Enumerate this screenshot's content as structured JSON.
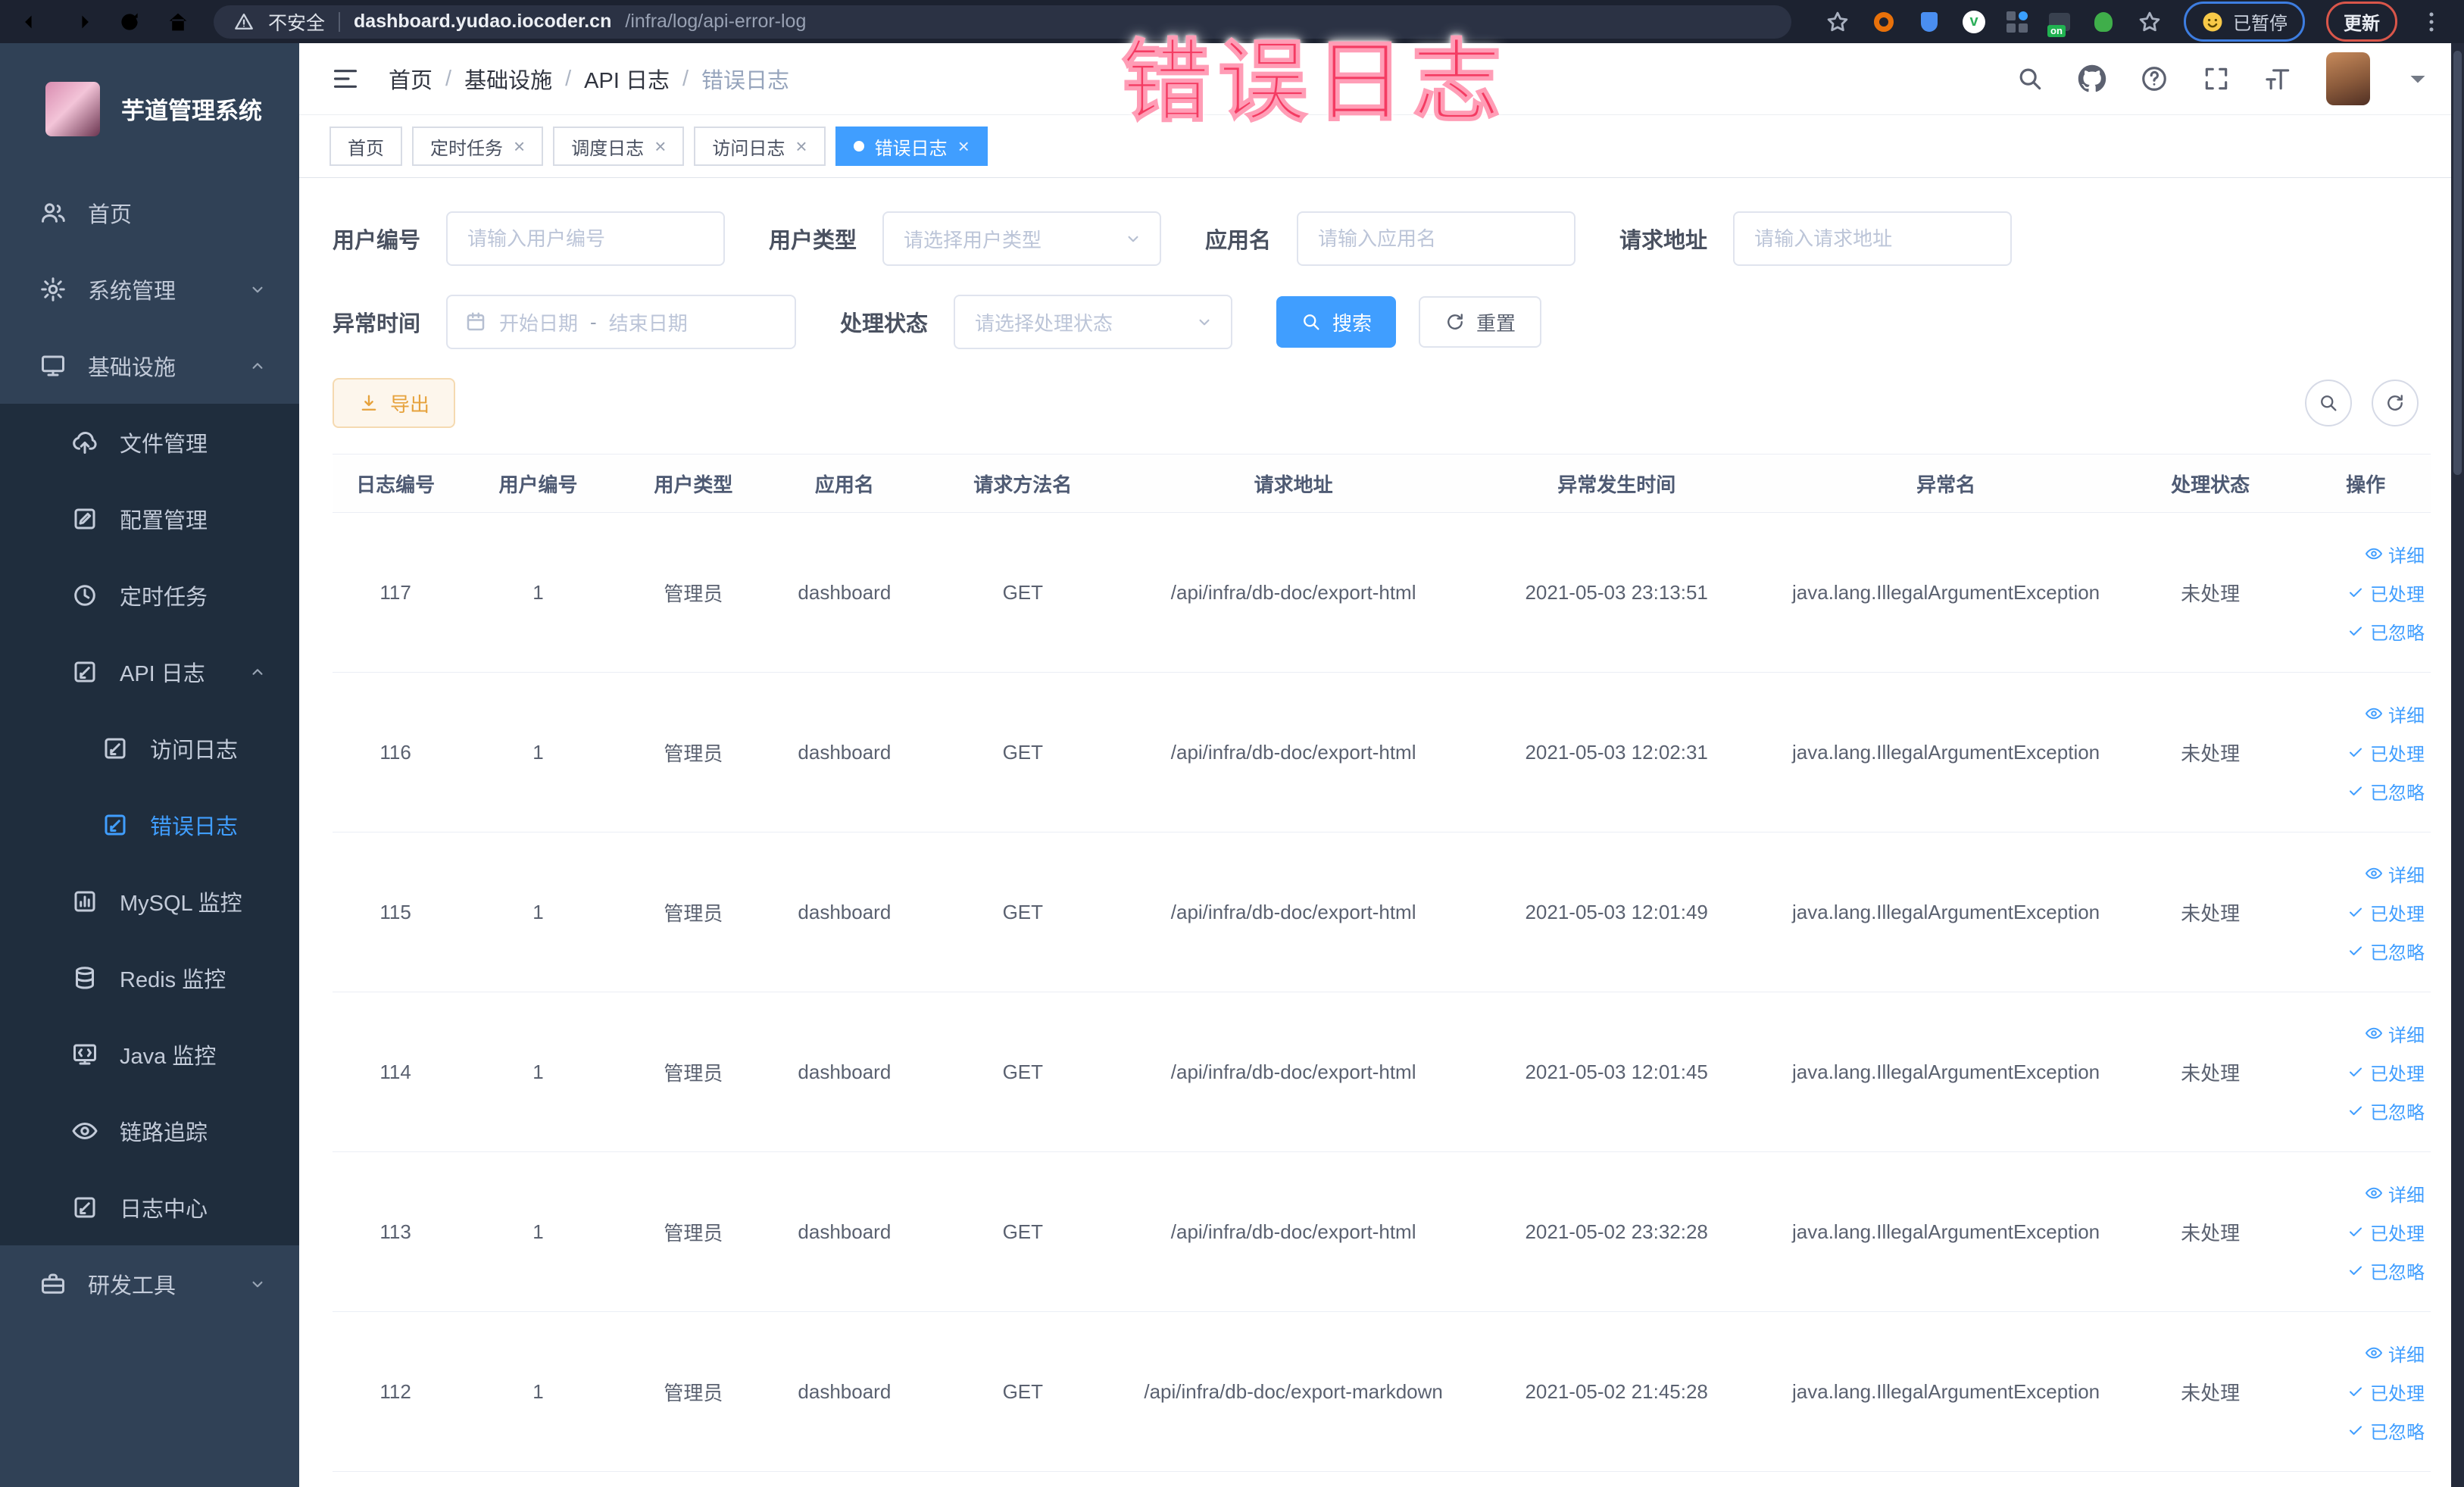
{
  "overlay": {
    "text": "错误日志"
  },
  "colors": {
    "accent": "#409eff",
    "warning": "#e6a23c",
    "overlay_red": "#f43b62",
    "sidebar_bg": "#304156",
    "submenu_bg": "#1f2d3d",
    "chrome_bg": "#1c2230"
  },
  "browser": {
    "security_text": "不安全",
    "url_host": "dashboard.yudao.iocoder.cn",
    "url_path": "/infra/log/api-error-log",
    "paused_label": "已暂停",
    "update_label": "更新"
  },
  "sidebar": {
    "title": "芋道管理系统",
    "items": [
      {
        "label": "首页",
        "icon": "peoples-icon",
        "level": 0
      },
      {
        "label": "系统管理",
        "icon": "gear-icon",
        "level": 0,
        "chevron": "down"
      },
      {
        "label": "基础设施",
        "icon": "monitor-icon",
        "level": 0,
        "chevron": "up"
      },
      {
        "label": "文件管理",
        "icon": "cloud-upload-icon",
        "level": 1
      },
      {
        "label": "配置管理",
        "icon": "edit-icon",
        "level": 1
      },
      {
        "label": "定时任务",
        "icon": "clock-icon",
        "level": 1
      },
      {
        "label": "API 日志",
        "icon": "log-icon",
        "level": 1,
        "chevron": "up"
      },
      {
        "label": "访问日志",
        "icon": "log-icon",
        "level": 2
      },
      {
        "label": "错误日志",
        "icon": "log-icon",
        "level": 2,
        "active": true
      },
      {
        "label": "MySQL 监控",
        "icon": "chart-icon",
        "level": 1
      },
      {
        "label": "Redis 监控",
        "icon": "layers-icon",
        "level": 1
      },
      {
        "label": "Java 监控",
        "icon": "java-icon",
        "level": 1
      },
      {
        "label": "链路追踪",
        "icon": "eye-icon",
        "level": 1
      },
      {
        "label": "日志中心",
        "icon": "log-icon",
        "level": 1
      },
      {
        "label": "研发工具",
        "icon": "toolbox-icon",
        "level": 0,
        "chevron": "down"
      }
    ]
  },
  "breadcrumb": [
    "首页",
    "基础设施",
    "API 日志",
    "错误日志"
  ],
  "tabs": [
    {
      "label": "首页",
      "closable": false,
      "active": false
    },
    {
      "label": "定时任务",
      "closable": true,
      "active": false
    },
    {
      "label": "调度日志",
      "closable": true,
      "active": false
    },
    {
      "label": "访问日志",
      "closable": true,
      "active": false
    },
    {
      "label": "错误日志",
      "closable": true,
      "active": true
    }
  ],
  "filters": {
    "user_id": {
      "label": "用户编号",
      "placeholder": "请输入用户编号"
    },
    "user_type": {
      "label": "用户类型",
      "placeholder": "请选择用户类型"
    },
    "app_name": {
      "label": "应用名",
      "placeholder": "请输入应用名"
    },
    "request_url": {
      "label": "请求地址",
      "placeholder": "请输入请求地址"
    },
    "exception_time": {
      "label": "异常时间",
      "start_placeholder": "开始日期",
      "separator": "-",
      "end_placeholder": "结束日期"
    },
    "process_status": {
      "label": "处理状态",
      "placeholder": "请选择处理状态"
    },
    "search_label": "搜索",
    "reset_label": "重置"
  },
  "toolbar": {
    "export_label": "导出"
  },
  "table": {
    "columns": [
      "日志编号",
      "用户编号",
      "用户类型",
      "应用名",
      "请求方法名",
      "请求地址",
      "异常发生时间",
      "异常名",
      "处理状态",
      "操作"
    ],
    "action_labels": [
      "详细",
      "已处理",
      "已忽略"
    ],
    "rows": [
      [
        "117",
        "1",
        "管理员",
        "dashboard",
        "GET",
        "/api/infra/db-doc/export-html",
        "2021-05-03 23:13:51",
        "java.lang.IllegalArgumentException",
        "未处理"
      ],
      [
        "116",
        "1",
        "管理员",
        "dashboard",
        "GET",
        "/api/infra/db-doc/export-html",
        "2021-05-03 12:02:31",
        "java.lang.IllegalArgumentException",
        "未处理"
      ],
      [
        "115",
        "1",
        "管理员",
        "dashboard",
        "GET",
        "/api/infra/db-doc/export-html",
        "2021-05-03 12:01:49",
        "java.lang.IllegalArgumentException",
        "未处理"
      ],
      [
        "114",
        "1",
        "管理员",
        "dashboard",
        "GET",
        "/api/infra/db-doc/export-html",
        "2021-05-03 12:01:45",
        "java.lang.IllegalArgumentException",
        "未处理"
      ],
      [
        "113",
        "1",
        "管理员",
        "dashboard",
        "GET",
        "/api/infra/db-doc/export-html",
        "2021-05-02 23:32:28",
        "java.lang.IllegalArgumentException",
        "未处理"
      ],
      [
        "112",
        "1",
        "管理员",
        "dashboard",
        "GET",
        "/api/infra/db-doc/export-markdown",
        "2021-05-02 21:45:28",
        "java.lang.IllegalArgumentException",
        "未处理"
      ]
    ]
  }
}
